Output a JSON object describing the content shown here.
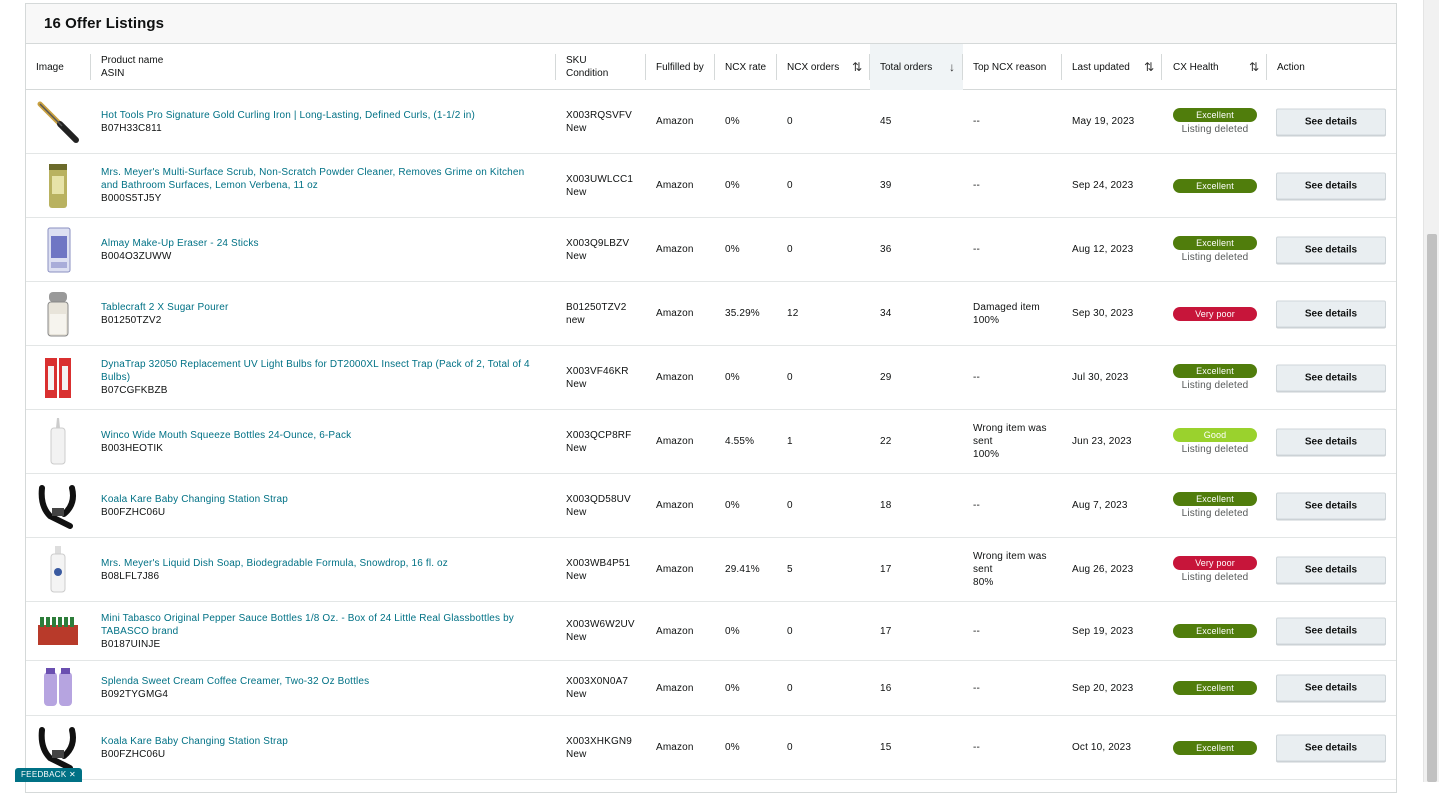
{
  "panel": {
    "title": "16 Offer Listings"
  },
  "columns": {
    "image": "Image",
    "product_name": "Product name",
    "asin": "ASIN",
    "sku": "SKU",
    "condition": "Condition",
    "fulfilled_by": "Fulfilled by",
    "ncx_rate": "NCX rate",
    "ncx_orders": "NCX orders",
    "total_orders": "Total orders",
    "top_ncx_reason": "Top NCX reason",
    "last_updated": "Last updated",
    "cx_health": "CX Health",
    "action": "Action"
  },
  "sort_icons": {
    "unsorted": "⇅",
    "descending": "↓"
  },
  "rows": [
    {
      "name": "Hot Tools Pro Signature Gold Curling Iron | Long-Lasting, Defined Curls, (1-1/2 in)",
      "asin": "B07H33C811",
      "sku": "X003RQSVFV",
      "condition": "New",
      "fulfilled_by": "Amazon",
      "ncx_rate": "0%",
      "ncx_orders": "0",
      "total_orders": "45",
      "reason": [
        "--"
      ],
      "last_updated": "May 19, 2023",
      "health": "Excellent",
      "health_class": "excellent",
      "status_note": "Listing deleted",
      "action": "See details",
      "image_icon": "curling-iron-icon"
    },
    {
      "name": "Mrs. Meyer's Multi-Surface Scrub, Non-Scratch Powder Cleaner, Removes Grime on Kitchen and Bathroom Surfaces, Lemon Verbena, 11 oz",
      "asin": "B000S5TJ5Y",
      "sku": "X003UWLCC1",
      "condition": "New",
      "fulfilled_by": "Amazon",
      "ncx_rate": "0%",
      "ncx_orders": "0",
      "total_orders": "39",
      "reason": [
        "--"
      ],
      "last_updated": "Sep 24, 2023",
      "health": "Excellent",
      "health_class": "excellent",
      "status_note": "",
      "action": "See details",
      "image_icon": "powder-canister-icon"
    },
    {
      "name": "Almay Make-Up Eraser - 24 Sticks",
      "asin": "B004O3ZUWW",
      "sku": "X003Q9LBZV",
      "condition": "New",
      "fulfilled_by": "Amazon",
      "ncx_rate": "0%",
      "ncx_orders": "0",
      "total_orders": "36",
      "reason": [
        "--"
      ],
      "last_updated": "Aug 12, 2023",
      "health": "Excellent",
      "health_class": "excellent",
      "status_note": "Listing deleted",
      "action": "See details",
      "image_icon": "makeup-box-icon"
    },
    {
      "name": "Tablecraft 2 X Sugar Pourer",
      "asin": "B01250TZV2",
      "sku": "B01250TZV2",
      "condition": "new",
      "fulfilled_by": "Amazon",
      "ncx_rate": "35.29%",
      "ncx_orders": "12",
      "total_orders": "34",
      "reason": [
        "Damaged item",
        "100%"
      ],
      "last_updated": "Sep 30, 2023",
      "health": "Very poor",
      "health_class": "verypoor",
      "status_note": "",
      "action": "See details",
      "image_icon": "sugar-pourer-icon"
    },
    {
      "name": "DynaTrap 32050 Replacement UV Light Bulbs for DT2000XL Insect Trap (Pack of 2, Total of 4 Bulbs)",
      "asin": "B07CGFKBZB",
      "sku": "X003VF46KR",
      "condition": "New",
      "fulfilled_by": "Amazon",
      "ncx_rate": "0%",
      "ncx_orders": "0",
      "total_orders": "29",
      "reason": [
        "--"
      ],
      "last_updated": "Jul 30, 2023",
      "health": "Excellent",
      "health_class": "excellent",
      "status_note": "Listing deleted",
      "action": "See details",
      "image_icon": "bulb-pack-icon"
    },
    {
      "name": "Winco Wide Mouth Squeeze Bottles 24-Ounce, 6-Pack",
      "asin": "B003HEOTIK",
      "sku": "X003QCP8RF",
      "condition": "New",
      "fulfilled_by": "Amazon",
      "ncx_rate": "4.55%",
      "ncx_orders": "1",
      "total_orders": "22",
      "reason": [
        "Wrong item was",
        "sent",
        "100%"
      ],
      "last_updated": "Jun 23, 2023",
      "health": "Good",
      "health_class": "good",
      "status_note": "Listing deleted",
      "action": "See details",
      "image_icon": "squeeze-bottle-icon"
    },
    {
      "name": "Koala Kare Baby Changing Station Strap",
      "asin": "B00FZHC06U",
      "sku": "X003QD58UV",
      "condition": "New",
      "fulfilled_by": "Amazon",
      "ncx_rate": "0%",
      "ncx_orders": "0",
      "total_orders": "18",
      "reason": [
        "--"
      ],
      "last_updated": "Aug 7, 2023",
      "health": "Excellent",
      "health_class": "excellent",
      "status_note": "Listing deleted",
      "action": "See details",
      "image_icon": "strap-icon"
    },
    {
      "name": "Mrs. Meyer's Liquid Dish Soap, Biodegradable Formula, Snowdrop, 16 fl. oz",
      "asin": "B08LFL7J86",
      "sku": "X003WB4P51",
      "condition": "New",
      "fulfilled_by": "Amazon",
      "ncx_rate": "29.41%",
      "ncx_orders": "5",
      "total_orders": "17",
      "reason": [
        "Wrong item was",
        "sent",
        "80%"
      ],
      "last_updated": "Aug 26, 2023",
      "health": "Very poor",
      "health_class": "verypoor",
      "status_note": "Listing deleted",
      "action": "See details",
      "image_icon": "soap-bottle-icon"
    },
    {
      "name": "Mini Tabasco Original Pepper Sauce Bottles 1/8 Oz. - Box of 24 Little Real Glassbottles by TABASCO brand",
      "asin": "B0187UINJE",
      "sku": "X003W6W2UV",
      "condition": "New",
      "fulfilled_by": "Amazon",
      "ncx_rate": "0%",
      "ncx_orders": "0",
      "total_orders": "17",
      "reason": [
        "--"
      ],
      "last_updated": "Sep 19, 2023",
      "health": "Excellent",
      "health_class": "excellent",
      "status_note": "",
      "action": "See details",
      "image_icon": "sauce-box-icon"
    },
    {
      "name": "Splenda Sweet Cream Coffee Creamer, Two-32 Oz Bottles",
      "asin": "B092TYGMG4",
      "sku": "X003X0N0A7",
      "condition": "New",
      "fulfilled_by": "Amazon",
      "ncx_rate": "0%",
      "ncx_orders": "0",
      "total_orders": "16",
      "reason": [
        "--"
      ],
      "last_updated": "Sep 20, 2023",
      "health": "Excellent",
      "health_class": "excellent",
      "status_note": "",
      "action": "See details",
      "image_icon": "creamer-bottles-icon"
    },
    {
      "name": "Koala Kare Baby Changing Station Strap",
      "asin": "B00FZHC06U",
      "sku": "X003XHKGN9",
      "condition": "New",
      "fulfilled_by": "Amazon",
      "ncx_rate": "0%",
      "ncx_orders": "0",
      "total_orders": "15",
      "reason": [
        "--"
      ],
      "last_updated": "Oct 10, 2023",
      "health": "Excellent",
      "health_class": "excellent",
      "status_note": "",
      "action": "See details",
      "image_icon": "strap-icon"
    }
  ],
  "feedback": {
    "label": "FEEDBACK ✕"
  },
  "colors": {
    "link": "#007185",
    "excellent": "#507d0c",
    "very_poor": "#c7153a",
    "good": "#9ad22d"
  }
}
